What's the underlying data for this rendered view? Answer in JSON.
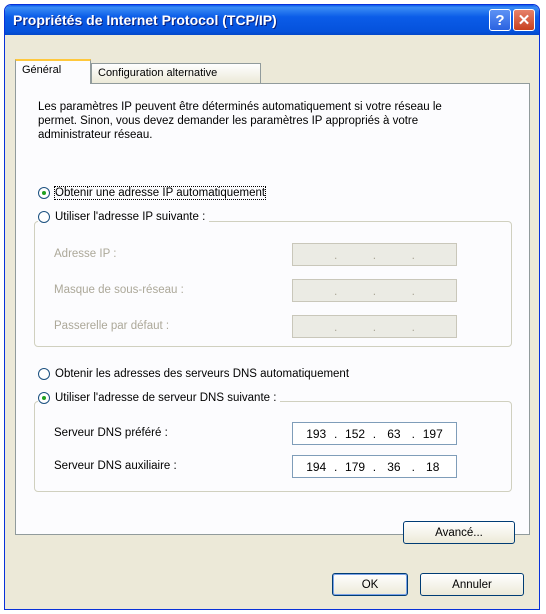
{
  "window": {
    "title": "Propriétés de Internet Protocol (TCP/IP)"
  },
  "titlebar": {
    "help_label": "?",
    "close_label": "✕"
  },
  "tabs": [
    {
      "label": "Général",
      "active": true
    },
    {
      "label": "Configuration alternative",
      "active": false
    }
  ],
  "description": "Les paramètres IP peuvent être déterminés automatiquement si votre réseau le permet. Sinon, vous devez demander les paramètres IP appropriés à votre administrateur réseau.",
  "ip_mode": {
    "auto_label": "Obtenir une adresse IP automatiquement",
    "auto_checked": true,
    "manual_label": "Utiliser l'adresse IP suivante :",
    "manual_checked": false
  },
  "ip_fields": [
    {
      "label": "Adresse IP :",
      "value": [
        "",
        "",
        "",
        ""
      ],
      "disabled": true
    },
    {
      "label": "Masque de sous-réseau :",
      "value": [
        "",
        "",
        "",
        ""
      ],
      "disabled": true
    },
    {
      "label": "Passerelle par défaut :",
      "value": [
        "",
        "",
        "",
        ""
      ],
      "disabled": true
    }
  ],
  "dns_mode": {
    "auto_label": "Obtenir les adresses des serveurs DNS automatiquement",
    "auto_checked": false,
    "manual_label": "Utiliser l'adresse de serveur DNS suivante :",
    "manual_checked": true
  },
  "dns_fields": [
    {
      "label": "Serveur DNS préféré :",
      "value": [
        "193",
        "152",
        "63",
        "197"
      ]
    },
    {
      "label": "Serveur DNS auxiliaire :",
      "value": [
        "194",
        "179",
        "36",
        "18"
      ]
    }
  ],
  "buttons": {
    "advanced": "Avancé...",
    "ok": "OK",
    "cancel": "Annuler"
  }
}
